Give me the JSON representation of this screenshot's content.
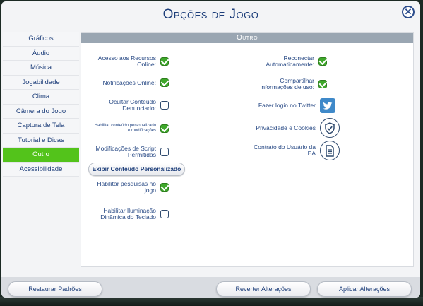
{
  "dialog": {
    "title": "Opções de Jogo"
  },
  "sidebar": {
    "items": [
      {
        "label": "Gráficos"
      },
      {
        "label": "Áudio"
      },
      {
        "label": "Música"
      },
      {
        "label": "Jogabilidade"
      },
      {
        "label": "Clima"
      },
      {
        "label": "Câmera do Jogo"
      },
      {
        "label": "Captura de Tela"
      },
      {
        "label": "Tutorial e Dicas"
      },
      {
        "label": "Outro",
        "active": true
      },
      {
        "label": "Acessibilidade"
      }
    ]
  },
  "panel": {
    "header": "Outro",
    "left_options": [
      {
        "label": "Acesso aos Recursos Online:",
        "checked": true
      },
      {
        "label": "Notificações Online:",
        "checked": true
      },
      {
        "label": "Ocultar Conteúdo Denunciado:",
        "checked": false
      },
      {
        "label": "Habilitar conteúdo personalizado e modificações",
        "checked": true
      },
      {
        "label": "Modificações de Script Permitidas",
        "checked": false
      },
      {
        "label": "Habilitar pesquisas no jogo",
        "checked": true
      },
      {
        "label": "Habilitar Iluminação Dinâmica do Teclado",
        "checked": false
      }
    ],
    "custom_content_button": "Exibir Conteúdo Personalizado",
    "right_options": [
      {
        "label": "Reconectar Automaticamente:",
        "checked": true
      },
      {
        "label": "Compartilhar informações de uso:",
        "checked": true
      }
    ],
    "links": [
      {
        "label": "Fazer login no Twitter",
        "icon": "twitter-icon"
      },
      {
        "label": "Privacidade e Cookies",
        "icon": "shield-check-icon"
      },
      {
        "label": "Contrato do Usuário da EA",
        "icon": "document-icon"
      }
    ]
  },
  "footer": {
    "restore_label": "Restaurar Padrões",
    "revert_label": "Reverter Alterações",
    "apply_label": "Aplicar Alterações"
  },
  "colors": {
    "accent_green": "#53c31b",
    "title_blue": "#1d3e7a",
    "header_gray": "#9aa6b2",
    "twitter_blue": "#3f89c9"
  }
}
